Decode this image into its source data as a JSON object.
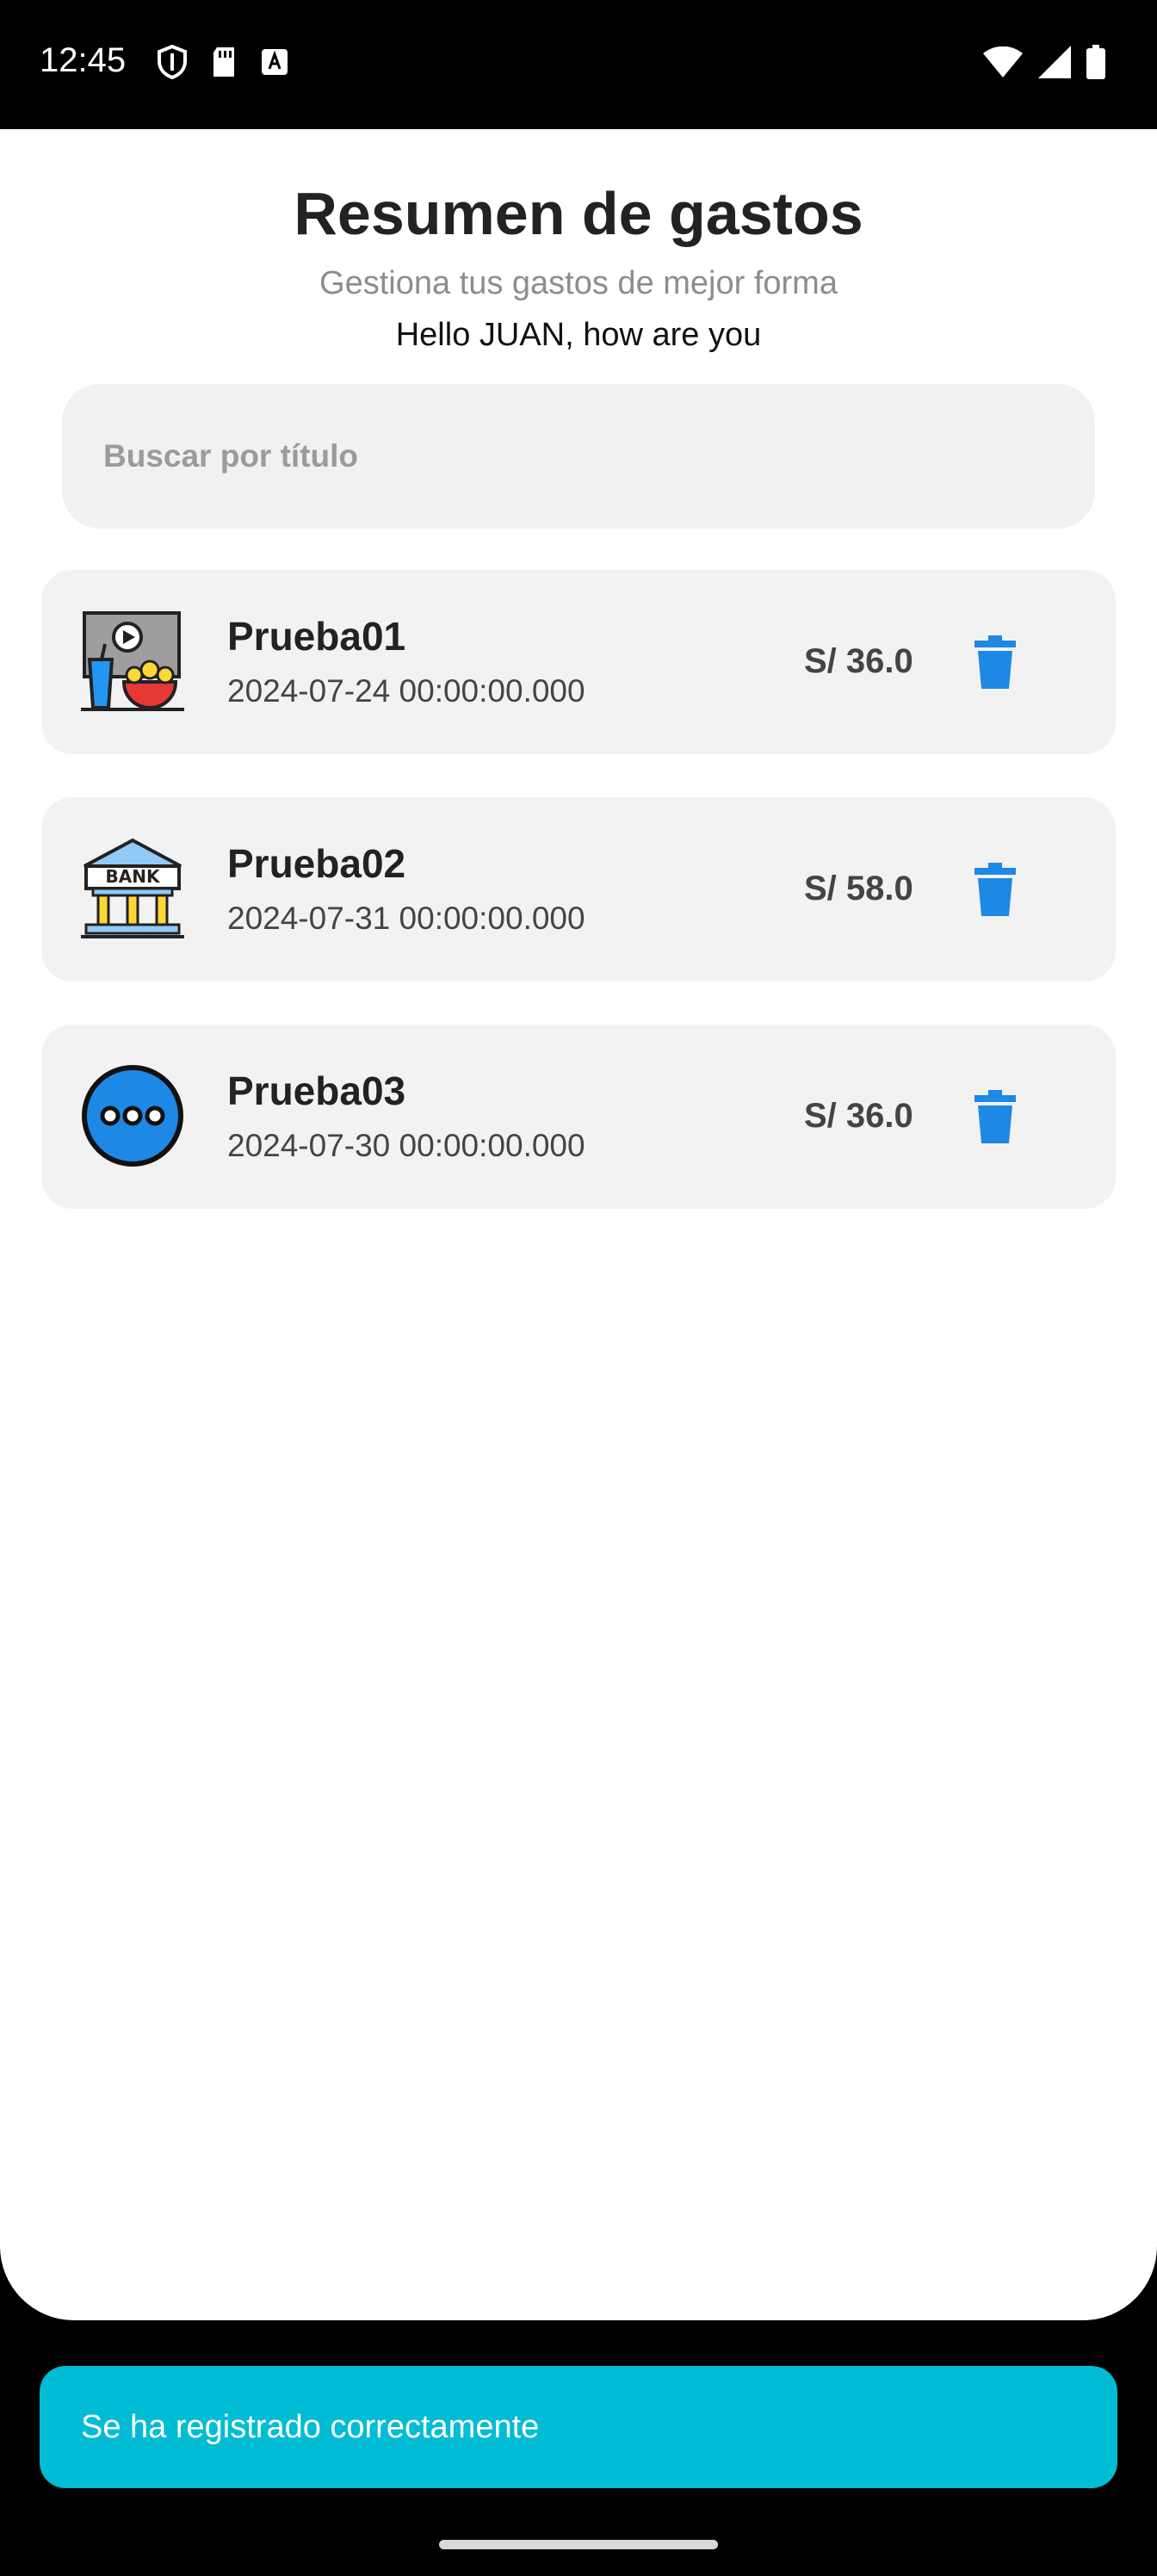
{
  "status_bar": {
    "time": "12:45"
  },
  "header": {
    "title": "Resumen de gastos",
    "subtitle": "Gestiona tus gastos de mejor forma",
    "greeting": "Hello JUAN, how are you"
  },
  "search": {
    "placeholder": "Buscar por título",
    "value": ""
  },
  "expenses": [
    {
      "title": "Prueba01",
      "date": "2024-07-24 00:00:00.000",
      "amount": "S/ 36.0",
      "icon": "cinema-icon"
    },
    {
      "title": "Prueba02",
      "date": "2024-07-31 00:00:00.000",
      "amount": "S/ 58.0",
      "icon": "bank-icon"
    },
    {
      "title": "Prueba03",
      "date": "2024-07-30 00:00:00.000",
      "amount": "S/ 36.0",
      "icon": "more-icon"
    }
  ],
  "snackbar": {
    "message": "Se ha registrado correctamente"
  },
  "colors": {
    "accent": "#1e88e5",
    "snackbar": "#00bcd4",
    "card_bg": "#f2f2f2"
  }
}
